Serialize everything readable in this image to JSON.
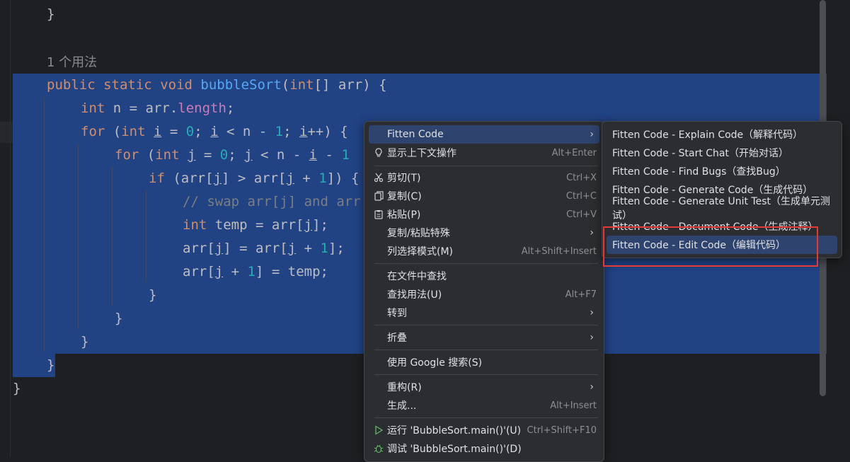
{
  "editor": {
    "usage_hint": "1 个用法",
    "lines": {
      "l0_close": "}",
      "sig_kw1": "public",
      "sig_kw2": "static",
      "sig_kw3": "void",
      "sig_name": "bubbleSort",
      "sig_open": "(",
      "sig_kw4": "int",
      "sig_rest": "[] arr) {",
      "l2_kw": "int",
      "l2_a": " n = arr.",
      "l2_field": "length",
      "l2_b": ";",
      "l3_kw": "for",
      "l3_a": " (",
      "l3_kw2": "int",
      "l3_sp": " ",
      "l3_i": "i",
      "l3_b": " = ",
      "l3_n0": "0",
      "l3_c": "; ",
      "l3_i2": "i",
      "l3_d": " < n - ",
      "l3_n1": "1",
      "l3_e": "; ",
      "l3_i3": "i",
      "l3_f": "++) {",
      "l4_kw": "for",
      "l4_a": " (",
      "l4_kw2": "int",
      "l4_sp": " ",
      "l4_j": "j",
      "l4_b": " = ",
      "l4_n0": "0",
      "l4_c": "; ",
      "l4_j2": "j",
      "l4_d": " < n - ",
      "l4_i": "i",
      "l4_e": " - ",
      "l4_n1": "1",
      "l5_kw": "if",
      "l5_a": " (arr[",
      "l5_j": "j",
      "l5_b": "] > arr[",
      "l5_j2": "j",
      "l5_c": " + ",
      "l5_n1": "1",
      "l5_d": "]) {",
      "l6_comment": "// swap arr[j] and arr",
      "l7_kw": "int",
      "l7_a": " temp = arr[",
      "l7_j": "j",
      "l7_b": "];",
      "l8_a": "arr[",
      "l8_j": "j",
      "l8_b": "] = arr[",
      "l8_j2": "j",
      "l8_c": " + ",
      "l8_n1": "1",
      "l8_d": "];",
      "l9_a": "arr[",
      "l9_j": "j",
      "l9_b": " + ",
      "l9_n1": "1",
      "l9_c": "] = temp;",
      "l10": "}",
      "l11": "}",
      "l12": "}",
      "l13": "}",
      "l14": "}"
    }
  },
  "context_menu": {
    "items": [
      {
        "label": "Fitten Code",
        "shortcut": "",
        "icon": ""
      },
      {
        "label": "显示上下文操作",
        "shortcut": "Alt+Enter",
        "icon": "lightbulb-icon"
      },
      {
        "label": "剪切(T)",
        "shortcut": "Ctrl+X",
        "icon": "scissors-icon"
      },
      {
        "label": "复制(C)",
        "shortcut": "Ctrl+C",
        "icon": "copy-icon"
      },
      {
        "label": "粘贴(P)",
        "shortcut": "Ctrl+V",
        "icon": "paste-icon"
      },
      {
        "label": "复制/粘贴特殊",
        "shortcut": "",
        "icon": ""
      },
      {
        "label": "列选择模式(M)",
        "shortcut": "Alt+Shift+Insert",
        "icon": ""
      },
      {
        "label": "在文件中查找",
        "shortcut": "",
        "icon": ""
      },
      {
        "label": "查找用法(U)",
        "shortcut": "Alt+F7",
        "icon": ""
      },
      {
        "label": "转到",
        "shortcut": "",
        "icon": ""
      },
      {
        "label": "折叠",
        "shortcut": "",
        "icon": ""
      },
      {
        "label": "使用 Google 搜索(S)",
        "shortcut": "",
        "icon": ""
      },
      {
        "label": "重构(R)",
        "shortcut": "",
        "icon": ""
      },
      {
        "label": "生成...",
        "shortcut": "Alt+Insert",
        "icon": ""
      },
      {
        "label": "运行 'BubbleSort.main()'(U)",
        "shortcut": "Ctrl+Shift+F10",
        "icon": "run-icon"
      },
      {
        "label": "调试 'BubbleSort.main()'(D)",
        "shortcut": "",
        "icon": "debug-icon"
      }
    ],
    "arrow": "›"
  },
  "submenu": {
    "items": [
      "Fitten Code - Explain Code（解释代码）",
      "Fitten Code - Start Chat（开始对话）",
      "Fitten Code - Find Bugs（查找Bug）",
      "Fitten Code - Generate Code（生成代码）",
      "Fitten Code - Generate Unit Test（生成单元测试）",
      "Fitten Code - Document Code（生成注释）",
      "Fitten Code - Edit Code（编辑代码）"
    ]
  },
  "colors": {
    "selection": "#214283",
    "menu_highlight": "#2e436e",
    "annotation_box": "#e53935"
  }
}
